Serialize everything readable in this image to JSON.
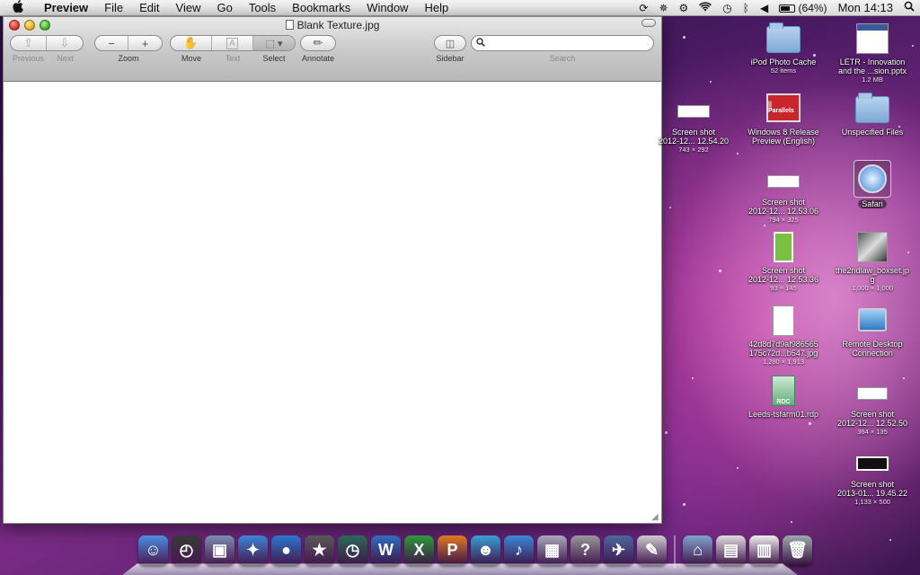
{
  "menubar": {
    "apple": "",
    "app_name": "Preview",
    "items": [
      "File",
      "Edit",
      "View",
      "Go",
      "Tools",
      "Bookmarks",
      "Window",
      "Help"
    ],
    "battery": "(64%)",
    "clock": "Mon 14:13"
  },
  "window": {
    "title": "Blank Texture.jpg",
    "toolbar": {
      "previous": "Previous",
      "next": "Next",
      "zoom": "Zoom",
      "move": "Move",
      "text": "Text",
      "select": "Select",
      "annotate": "Annotate",
      "sidebar": "Sidebar",
      "search": "Search",
      "search_value": ""
    }
  },
  "desktop": {
    "items": [
      {
        "name": "iPod Photo Cache",
        "meta": "52 items",
        "icon": "folder-icon"
      },
      {
        "name": "LETR - Innovation",
        "name2": "and the ...sion.pptx",
        "meta": "1.2 MB",
        "icon": "pptx-icon"
      },
      {
        "name": "Screen shot",
        "name2": "2012-12... 12.54.20",
        "meta": "743 × 292",
        "icon": "screenshot-icon"
      },
      {
        "name": "Windows 8 Release",
        "name2": "Preview (English)",
        "icon": "parallels-icon",
        "badge": "|| Parallels"
      },
      {
        "name": "Unspecified Files",
        "icon": "folder-icon"
      },
      {
        "name": "Screen shot",
        "name2": "2012-12... 12.53.06",
        "meta": "794 × 325",
        "icon": "screenshot-icon"
      },
      {
        "name": "Safari",
        "icon": "safari-icon"
      },
      {
        "name": "Screen shot",
        "name2": "2012-12... 12.53.36",
        "meta": "93 × 145",
        "icon": "screenshot-icon"
      },
      {
        "name": "the2ndlaw_boxset.jp",
        "name2": "g",
        "meta": "1,000 × 1,000",
        "icon": "image-icon"
      },
      {
        "name": "42d8d7d9af986565",
        "name2": "175c72d...b547.jpg",
        "meta": "1,280 × 1,913",
        "icon": "image-icon"
      },
      {
        "name": "Remote Desktop",
        "name2": "Connection",
        "icon": "remote-desktop-icon"
      },
      {
        "name": "Leeds-tsfarm01.rdp",
        "icon": "rdp-icon",
        "badge": "RDC"
      },
      {
        "name": "Screen shot",
        "name2": "2012-12... 12.52.50",
        "meta": "364 × 135",
        "icon": "screenshot-icon"
      },
      {
        "name": "Screen shot",
        "name2": "2013-01... 19.45.22",
        "meta": "1,133 × 500",
        "icon": "screenshot-icon"
      }
    ]
  },
  "dock": {
    "apps": [
      {
        "name": "finder",
        "glyph": "☺",
        "color": "#4b8fe0"
      },
      {
        "name": "dashboard",
        "glyph": "◴",
        "color": "#3a3a3a"
      },
      {
        "name": "preview",
        "glyph": "▣",
        "color": "#7a8fb0"
      },
      {
        "name": "safari",
        "glyph": "✦",
        "color": "#3c86d8"
      },
      {
        "name": "facetime",
        "glyph": "●",
        "color": "#2c78d0"
      },
      {
        "name": "imovie",
        "glyph": "★",
        "color": "#5a5a5a"
      },
      {
        "name": "time-machine",
        "glyph": "◷",
        "color": "#2a6a5a"
      },
      {
        "name": "word",
        "glyph": "W",
        "color": "#2e6fc0"
      },
      {
        "name": "excel",
        "glyph": "X",
        "color": "#2e9a3c"
      },
      {
        "name": "powerpoint",
        "glyph": "P",
        "color": "#e07a20"
      },
      {
        "name": "messenger",
        "glyph": "☻",
        "color": "#3aa0d8"
      },
      {
        "name": "itunes",
        "glyph": "♪",
        "color": "#3a8ad8"
      },
      {
        "name": "calculator",
        "glyph": "▦",
        "color": "#aab"
      },
      {
        "name": "help",
        "glyph": "?",
        "color": "#999"
      },
      {
        "name": "app-store",
        "glyph": "✈",
        "color": "#4a6a9a"
      },
      {
        "name": "textedit",
        "glyph": "✎",
        "color": "#ccc"
      }
    ],
    "stacks": [
      {
        "name": "applications-folder",
        "glyph": "⌂",
        "color": "#7fa3cc"
      },
      {
        "name": "documents-stack",
        "glyph": "▤",
        "color": "#ddd"
      },
      {
        "name": "downloads-stack",
        "glyph": "▥",
        "color": "#eee"
      },
      {
        "name": "trash",
        "glyph": "🗑",
        "color": "#9aa"
      }
    ]
  }
}
